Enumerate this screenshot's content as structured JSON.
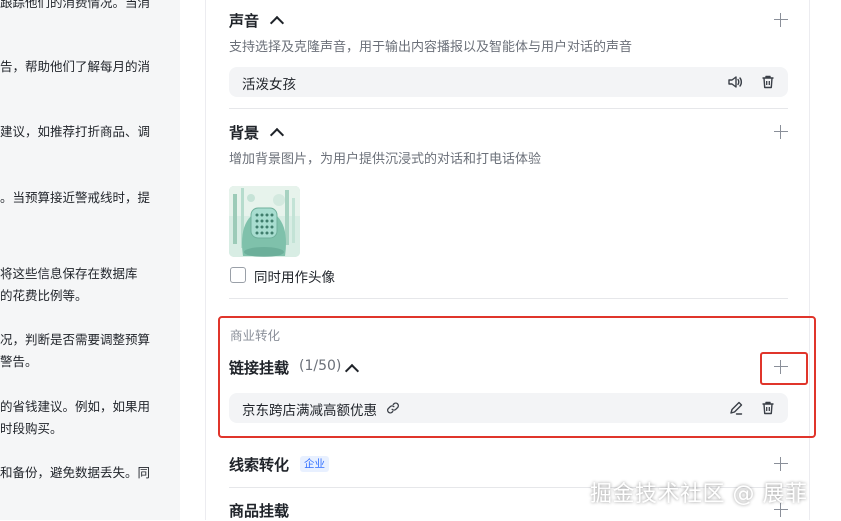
{
  "left_panel": {
    "lines": [
      "跟踪他们的消费情况。当消",
      "告，帮助他们了解每月的消",
      "建议，如推荐打折商品、调",
      "。当预算接近警戒线时，提",
      "将这些信息保存在数据库",
      "的花费比例等。",
      "况，判断是否需要调整预算",
      "警告。",
      "的省钱建议。例如，如果用",
      "时段购买。",
      "和备份，避免数据丢失。同"
    ]
  },
  "voice": {
    "title": "声音",
    "desc": "支持选择及克隆声音，用于输出内容播报以及智能体与用户对话的声音",
    "item": "活泼女孩"
  },
  "background": {
    "title": "背景",
    "desc": "增加背景图片，为用户提供沉浸式的对话和打电话体验",
    "checkbox_label": "同时用作头像"
  },
  "commerce": {
    "group_label": "商业转化",
    "link": {
      "title": "链接挂载",
      "count": "(1/50)",
      "item": "京东跨店满减高额优惠"
    },
    "leads": {
      "title": "线索转化",
      "badge": "企业"
    },
    "product": {
      "title": "商品挂载"
    }
  },
  "watermark": "掘金技术社区 @ 展菲",
  "colors": {
    "highlight": "#e0352b",
    "badge_text": "#3370ff",
    "pill_bg": "#f3f4f6"
  }
}
